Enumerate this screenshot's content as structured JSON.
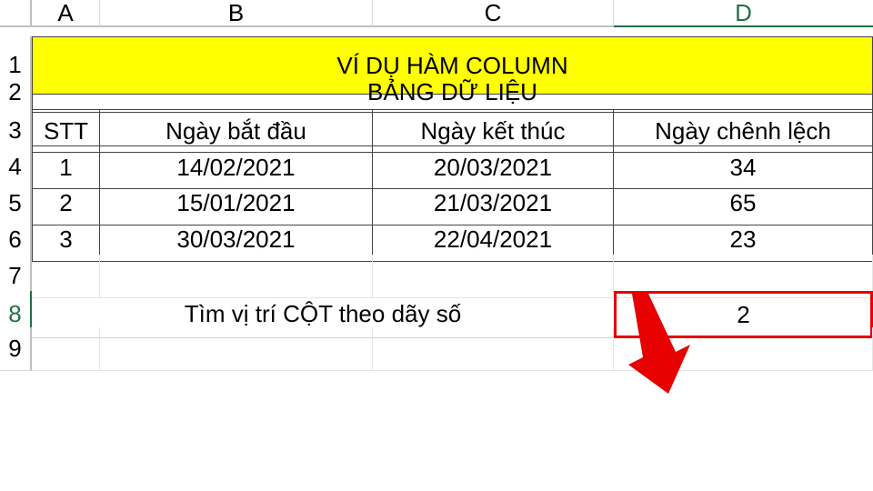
{
  "columns": [
    "A",
    "B",
    "C",
    "D"
  ],
  "rows": [
    "1",
    "2",
    "3",
    "4",
    "5",
    "6",
    "7",
    "8",
    "9"
  ],
  "selected_column": "D",
  "selected_row": "8",
  "title": "VÍ DỤ HÀM COLUMN",
  "subtitle": "BẢNG DỮ LIỆU",
  "headers": {
    "stt": "STT",
    "start": "Ngày bắt đầu",
    "end": "Ngày kết thúc",
    "diff": "Ngày chênh lệch"
  },
  "table": [
    {
      "stt": "1",
      "start": "14/02/2021",
      "end": "20/03/2021",
      "diff": "34"
    },
    {
      "stt": "2",
      "start": "15/01/2021",
      "end": "21/03/2021",
      "diff": "65"
    },
    {
      "stt": "3",
      "start": "30/03/2021",
      "end": "22/04/2021",
      "diff": "23"
    }
  ],
  "find_label": "Tìm vị trí CỘT theo dãy số",
  "result": "2",
  "arrow_color": "#e60000"
}
